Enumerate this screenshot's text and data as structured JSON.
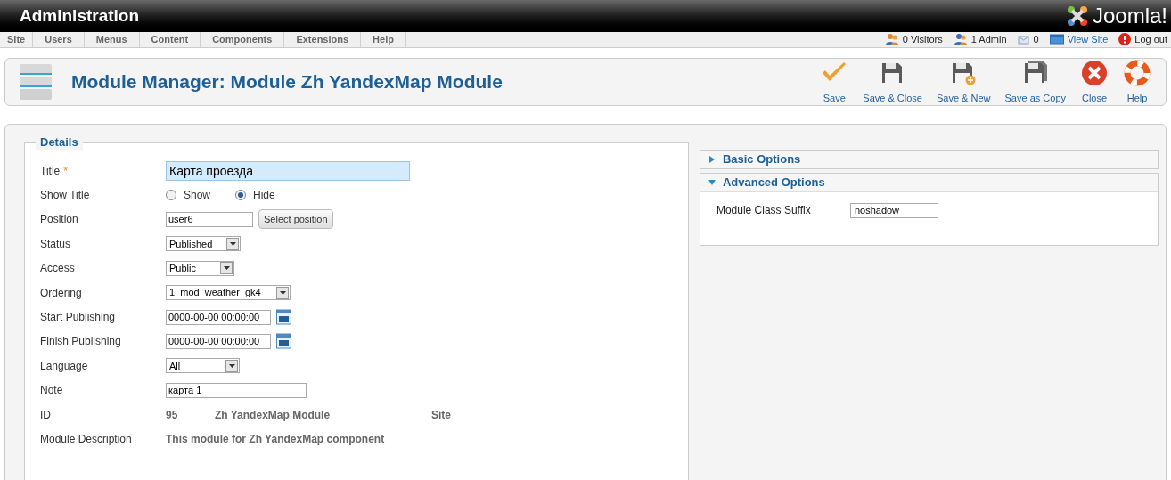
{
  "header": {
    "title": "Administration",
    "logo_text": "Joomla!"
  },
  "menu": [
    "Site",
    "Users",
    "Menus",
    "Content",
    "Components",
    "Extensions",
    "Help"
  ],
  "status": [
    {
      "kind": "visitors",
      "text": "0 Visitors"
    },
    {
      "kind": "admin",
      "text": "1 Admin"
    },
    {
      "kind": "messages",
      "text": "0"
    },
    {
      "kind": "view_site",
      "text": "View Site"
    },
    {
      "kind": "logout",
      "text": "Log out"
    }
  ],
  "toolbar": {
    "title": "Module Manager: Module Zh YandexMap Module",
    "buttons": [
      {
        "kind": "save",
        "label": "Save"
      },
      {
        "kind": "save_close",
        "label": "Save & Close"
      },
      {
        "kind": "save_new",
        "label": "Save & New"
      },
      {
        "kind": "save_copy",
        "label": "Save as Copy"
      },
      {
        "kind": "close",
        "label": "Close"
      },
      {
        "kind": "help",
        "label": "Help"
      }
    ]
  },
  "details": {
    "legend": "Details",
    "fields": [
      {
        "kind": "text",
        "label": "Title",
        "required": true,
        "required_mark": "*",
        "focused": true,
        "value": "Карта проезда"
      },
      {
        "kind": "radio",
        "label": "Show Title",
        "options": [
          {
            "label": "Show",
            "selected": false
          },
          {
            "label": "Hide",
            "selected": true
          }
        ]
      },
      {
        "kind": "position",
        "label": "Position",
        "value": "user6",
        "button": "Select position"
      },
      {
        "kind": "select",
        "label": "Status",
        "value": "Published"
      },
      {
        "kind": "select",
        "label": "Access",
        "value": "Public"
      },
      {
        "kind": "select",
        "label": "Ordering",
        "value": "1. mod_weather_gk4"
      },
      {
        "kind": "date",
        "label": "Start Publishing",
        "value": "0000-00-00 00:00:00"
      },
      {
        "kind": "date",
        "label": "Finish Publishing",
        "value": "0000-00-00 00:00:00"
      },
      {
        "kind": "select",
        "label": "Language",
        "value": "All"
      },
      {
        "kind": "note",
        "label": "Note",
        "value": "карта 1"
      },
      {
        "kind": "info",
        "label": "ID",
        "values": [
          "95",
          "Zh YandexMap Module",
          "Site"
        ]
      },
      {
        "kind": "info",
        "label": "Module Description",
        "values": [
          "This module for Zh YandexMap component"
        ]
      }
    ]
  },
  "options": [
    {
      "title": "Basic Options",
      "expanded": false
    },
    {
      "title": "Advanced Options",
      "expanded": true,
      "fields": [
        {
          "label": "Module Class Suffix",
          "value": "noshadow"
        }
      ]
    }
  ]
}
